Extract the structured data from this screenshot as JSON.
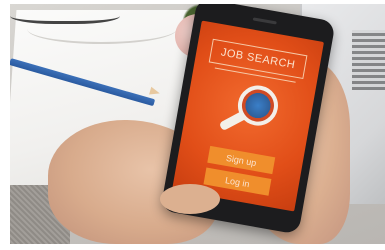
{
  "app": {
    "title": "JOB SEARCH",
    "buttons": {
      "signup_label": "Sign up",
      "login_label": "Log in"
    }
  },
  "colors": {
    "screen_bg": "#e14e18",
    "button_bg": "#f08e2c",
    "title_text": "#fbe3cf"
  },
  "icons": {
    "magnifier": "magnifying-glass-icon"
  }
}
